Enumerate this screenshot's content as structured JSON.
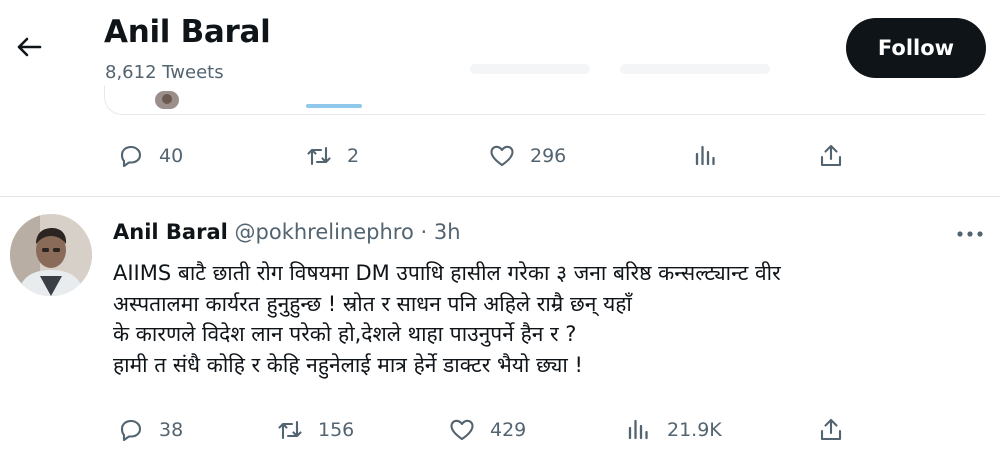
{
  "header": {
    "title": "Anil Baral",
    "tweet_count": "8,612 Tweets",
    "follow_label": "Follow"
  },
  "top_tweet_actions": {
    "replies": "40",
    "retweets": "2",
    "likes": "296"
  },
  "tweet": {
    "name": "Anil Baral",
    "handle": "@pokhrelinephro",
    "dot": "·",
    "time": "3h",
    "lines": [
      "AIIMS बाटै  छाती रोग विषयमा DM उपाधि हासील गरेका ३ जना बरिष्ठ कन्सल्ट्यान्ट  वीर",
      "अस्पतालमा कार्यरत हुनुहुन्छ ! स्रोत र साधन पनि अहिले राम्रै छन् यहाँ",
      "के कारणले विदेश लान परेको हो,देशले थाहा पाउनुपर्ने हैन र ?",
      "हामी त संधै कोहि र केहि नहुनेलाई मात्र हेर्ने डाक्टर भैयो छ्या !"
    ],
    "actions": {
      "replies": "38",
      "retweets": "156",
      "likes": "429",
      "views": "21.9K"
    }
  },
  "colors": {
    "text": "#0f1419",
    "secondary": "#536471",
    "follow_bg": "#0f1419",
    "accent": "#1d9bf0"
  },
  "icons": [
    "back-arrow-icon",
    "reply-icon",
    "retweet-icon",
    "like-icon",
    "views-icon",
    "share-icon",
    "more-icon"
  ]
}
